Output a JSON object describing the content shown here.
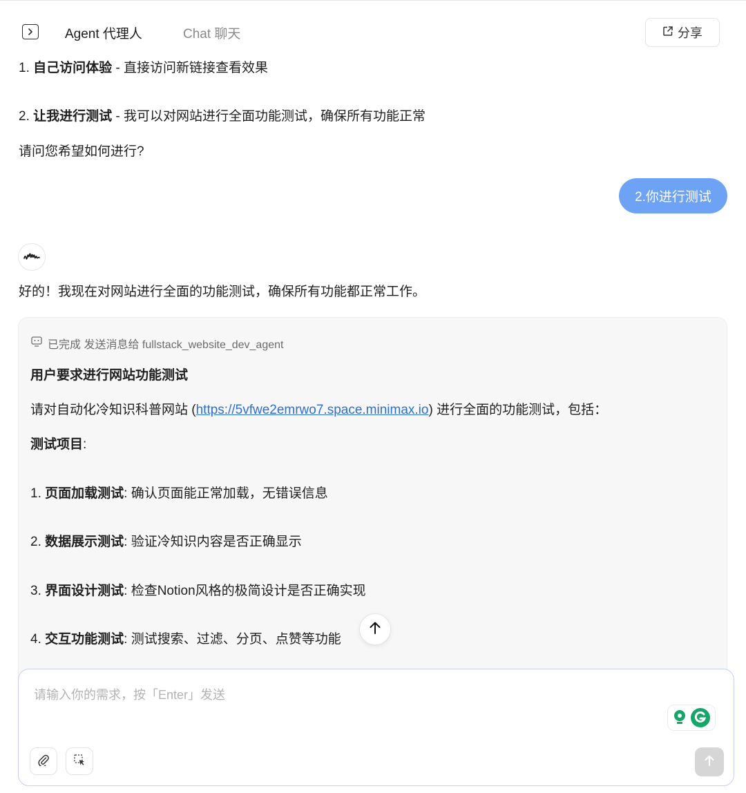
{
  "header": {
    "agent_tab": "Agent 代理人",
    "chat_tab": "Chat 聊天",
    "share_label": "分享"
  },
  "conversation": {
    "option1_num": "1.",
    "option1_title": "自己访问体验",
    "option1_desc": " - 直接访问新链接查看效果",
    "option2_num": "2.",
    "option2_title": "让我进行测试",
    "option2_desc": " - 我可以对网站进行全面功能测试，确保所有功能正常",
    "question": "请问您希望如何进行?",
    "user_reply": "2.你进行测试",
    "ai_reply": "好的！我现在对网站进行全面的功能测试，确保所有功能都正常工作。"
  },
  "task_card": {
    "status": "已完成 发送消息给 fullstack_website_dev_agent",
    "heading": "用户要求进行网站功能测试",
    "intro_prefix": "请对自动化冷知识科普网站 (",
    "intro_link": "https://5vfwe2emrwo7.space.minimax.io",
    "intro_suffix": ") 进行全面的功能测试，包括：",
    "items_label": "测试项目",
    "items_colon": ":",
    "items": [
      {
        "num": "1.",
        "title": "页面加载测试",
        "desc": ": 确认页面能正常加载，无错误信息"
      },
      {
        "num": "2.",
        "title": "数据展示测试",
        "desc": ": 验证冷知识内容是否正确显示"
      },
      {
        "num": "3.",
        "title": "界面设计测试",
        "desc": ": 检查Notion风格的极简设计是否正确实现"
      },
      {
        "num": "4.",
        "title": "交互功能测试",
        "desc": ": 测试搜索、过滤、分页、点赞等功能"
      }
    ]
  },
  "composer": {
    "placeholder": "请输入你的需求，按「Enter」发送"
  },
  "icons": {
    "sidebar": "sidebar-toggle-icon",
    "share": "share-icon",
    "avatar": "soundwave-icon",
    "status": "agent-message-icon",
    "scroll": "arrow-up-icon",
    "attach": "paperclip-icon",
    "select": "screen-select-icon",
    "send": "send-arrow-icon",
    "grammarly": "grammarly-icon"
  },
  "colors": {
    "user_bubble": "#6ea2f5",
    "link": "#2c6fd6",
    "composer_border": "#c9cdf7",
    "grammarly_green": "#15a66a"
  }
}
